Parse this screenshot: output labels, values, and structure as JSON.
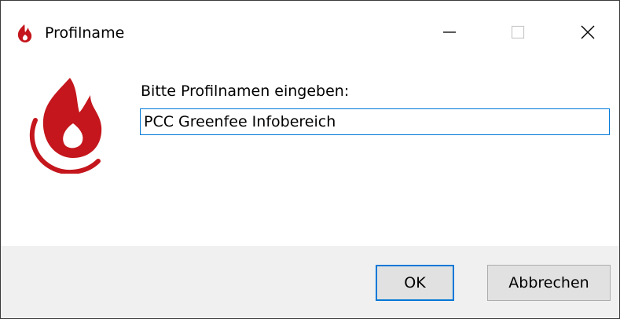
{
  "window": {
    "title": "Profilname",
    "icon": "flame-icon",
    "controls": {
      "minimize_glyph": "—",
      "maximize_glyph": "☐",
      "close_glyph": "✕"
    }
  },
  "dialog": {
    "prompt": "Bitte Profilnamen eingeben:",
    "profile_name_value": "PCC Greenfee Infobereich",
    "logo": "flame-logo-icon"
  },
  "buttons": {
    "ok_label": "OK",
    "cancel_label": "Abbrechen"
  },
  "colors": {
    "brand_red": "#c4161c",
    "focus_blue": "#0078d7",
    "footer_bg": "#f0f0f0",
    "button_bg": "#e1e1e1"
  }
}
